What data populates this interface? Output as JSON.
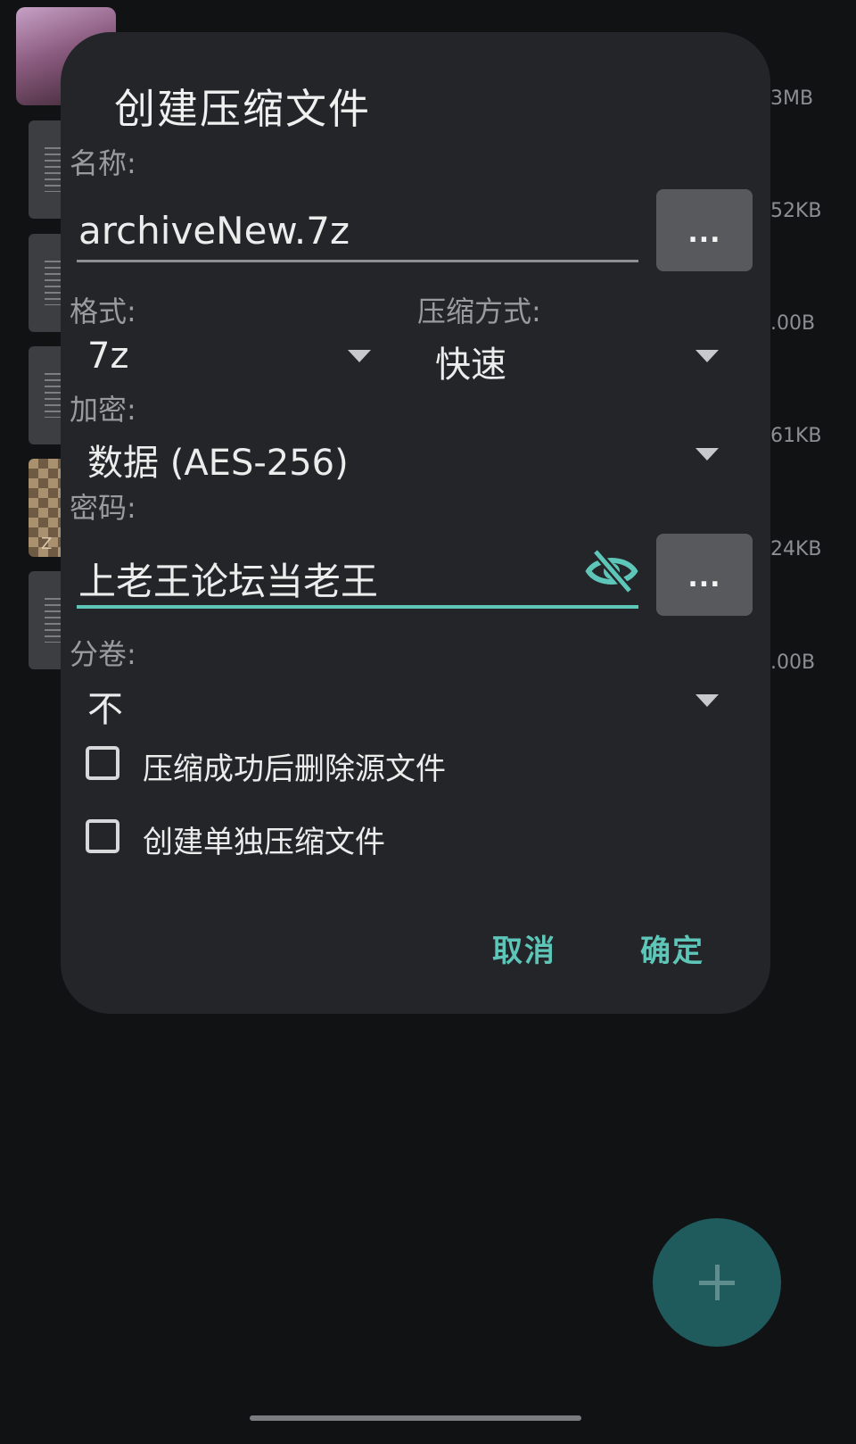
{
  "background": {
    "sizes": [
      "3MB",
      "52KB",
      ".00B",
      "61KB",
      "24KB",
      ".00B"
    ],
    "zip_label": "Z"
  },
  "dialog": {
    "title": "创建压缩文件",
    "name_label": "名称:",
    "name_value": "archiveNew.7z",
    "browse_label": "...",
    "format_label": "格式:",
    "format_value": "7z",
    "method_label": "压缩方式:",
    "method_value": "快速",
    "encryption_label": "加密:",
    "encryption_value": "数据 (AES-256)",
    "password_label": "密码:",
    "password_value": "上老王论坛当老王",
    "password_more_label": "...",
    "split_label": "分卷:",
    "split_value": "不",
    "delete_source_label": "压缩成功后删除源文件",
    "delete_source_checked": false,
    "separate_archives_label": "创建单独压缩文件",
    "separate_archives_checked": false,
    "cancel_label": "取消",
    "ok_label": "确定"
  },
  "colors": {
    "accent": "#5ec6b9",
    "dialog_bg": "#242528",
    "screen_bg": "#111214",
    "fab": "#1f5a5c"
  },
  "icons": {
    "password_toggle": "eye-off-icon",
    "fab": "plus-icon",
    "dropdown": "caret-down-icon"
  }
}
